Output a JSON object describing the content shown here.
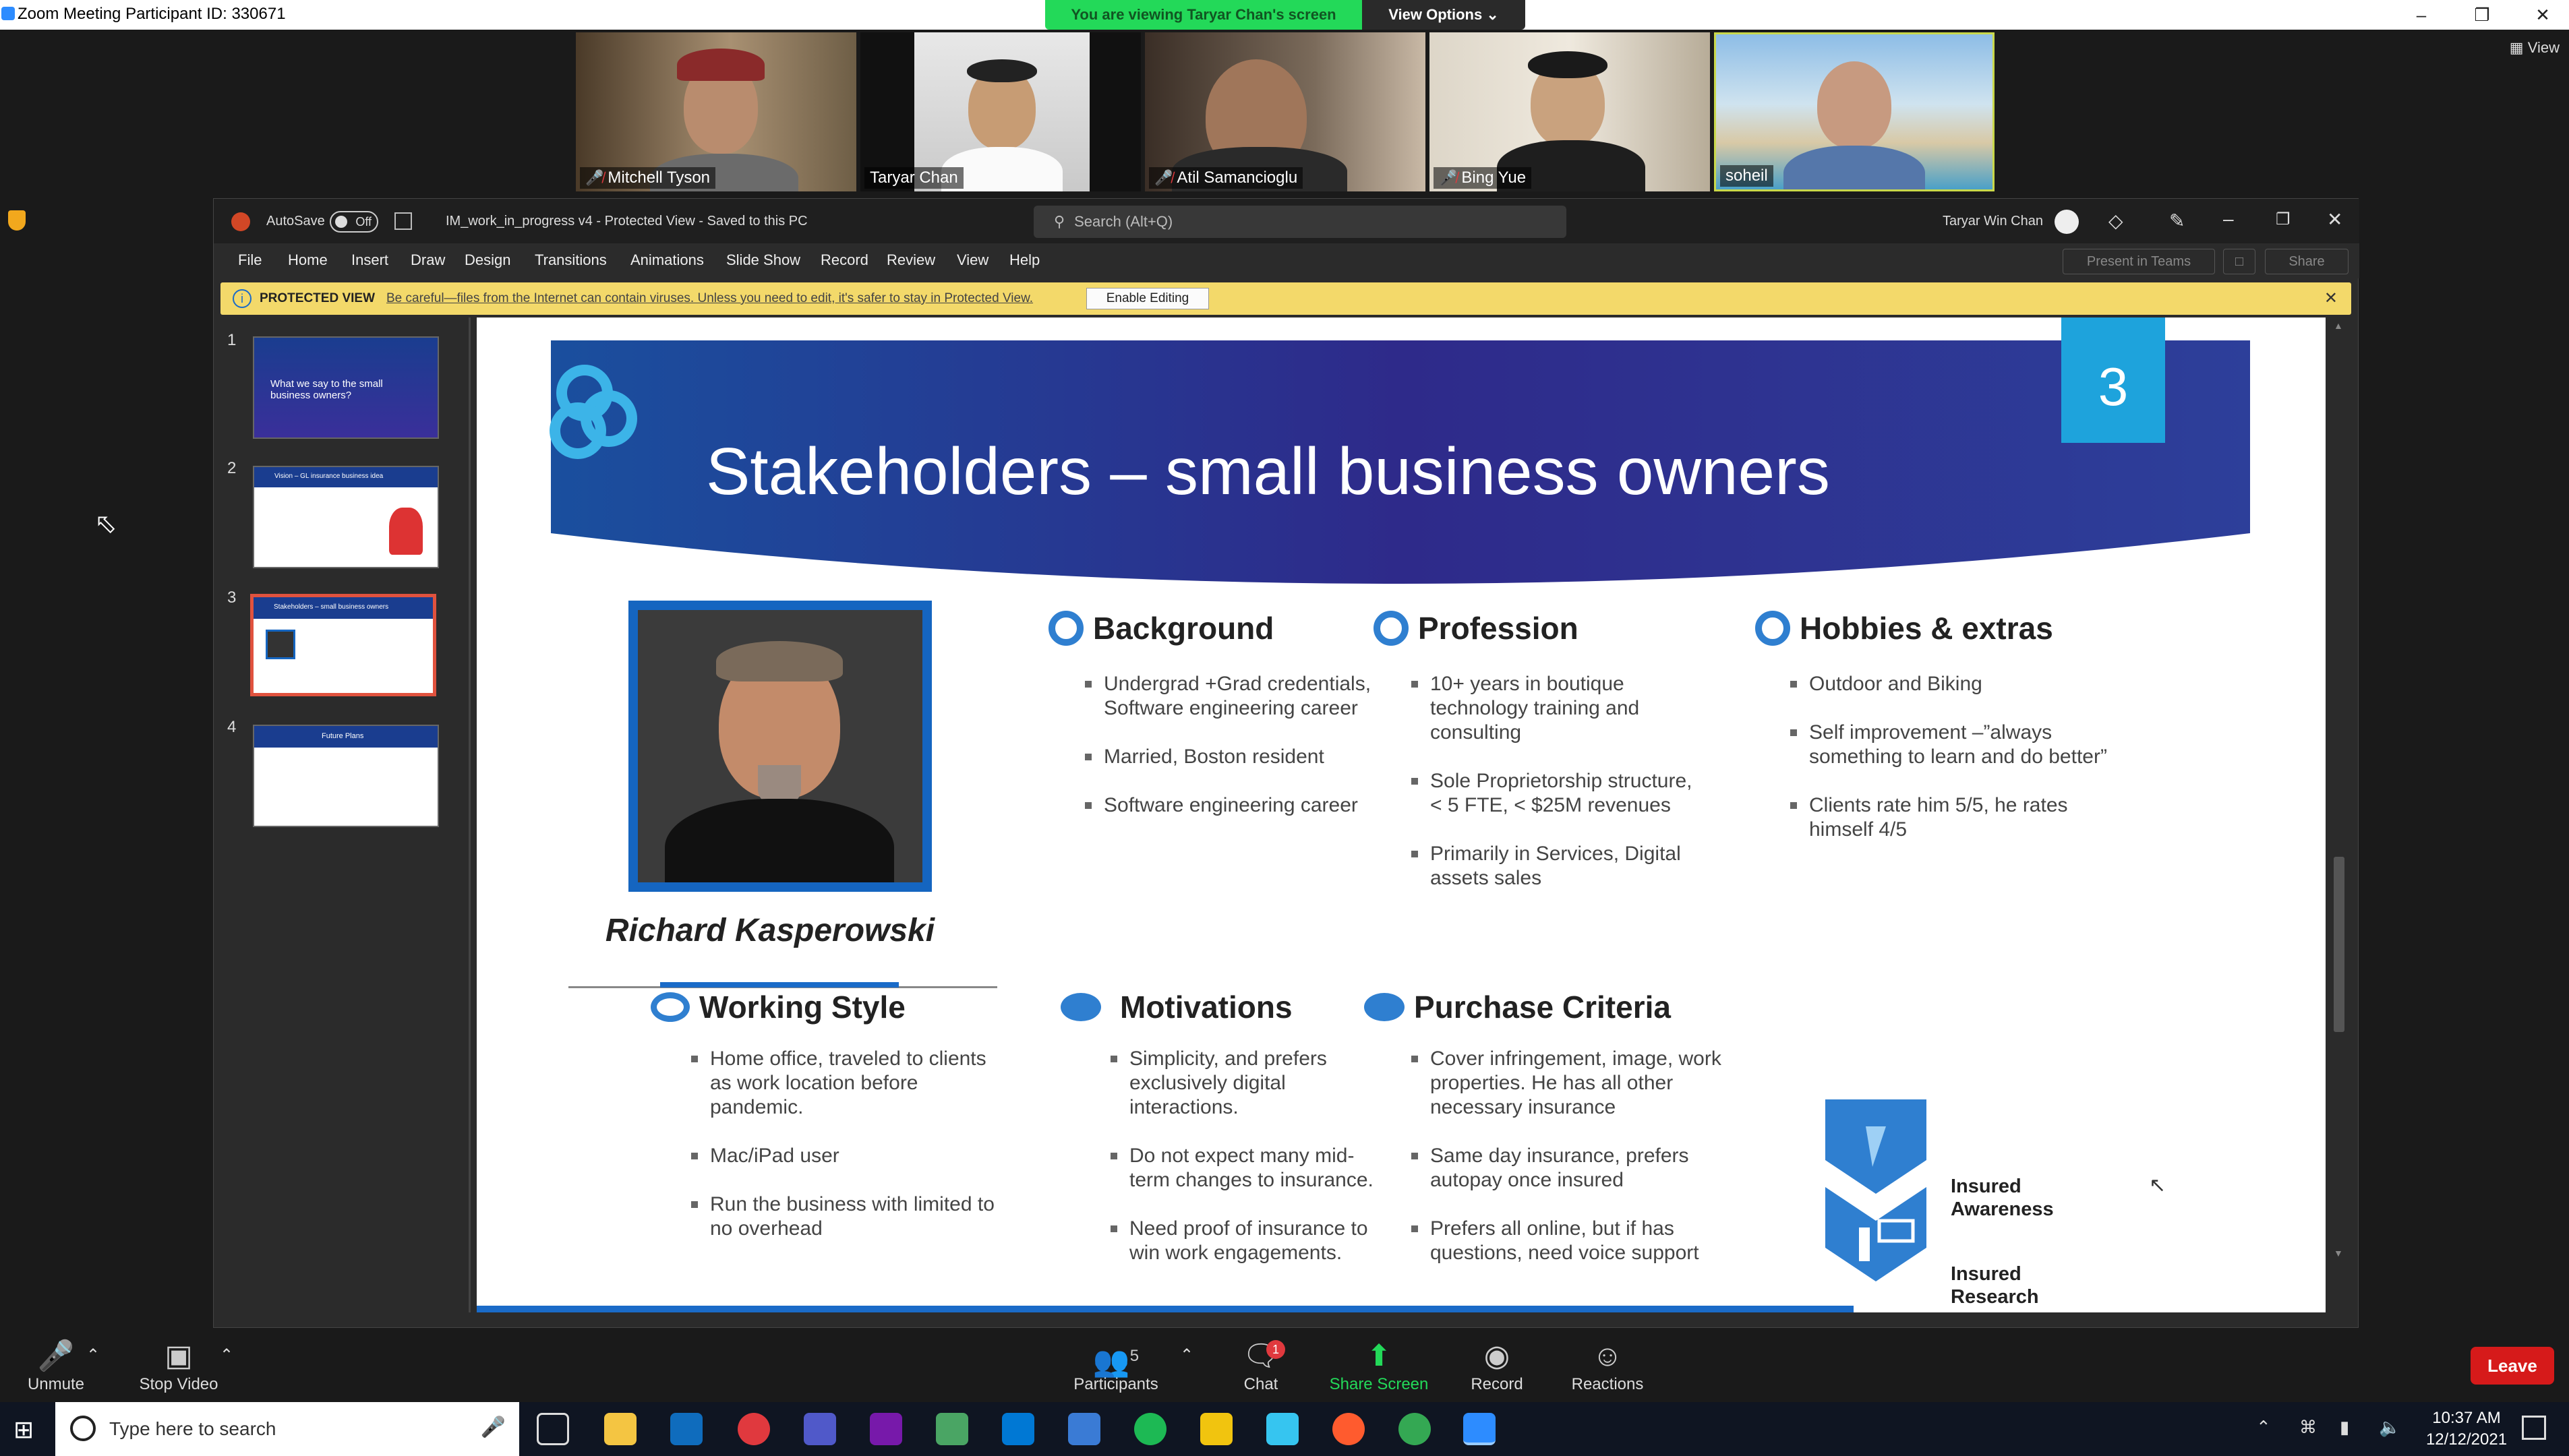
{
  "zoom": {
    "window_title": "Zoom Meeting Participant ID: 330671",
    "viewing_banner": "You are viewing Taryar Chan's screen",
    "view_options": "View Options",
    "view_button": "View",
    "participants": [
      {
        "name": "Mitchell Tyson",
        "muted": true
      },
      {
        "name": "Taryar Chan",
        "muted": false
      },
      {
        "name": "Atil Samancioglu",
        "muted": true
      },
      {
        "name": "Bing Yue",
        "muted": true
      },
      {
        "name": "soheil",
        "muted": false
      }
    ],
    "toolbar": {
      "unmute": "Unmute",
      "stop_video": "Stop Video",
      "participants": "Participants",
      "participants_count": "5",
      "chat": "Chat",
      "chat_badge": "1",
      "share_screen": "Share Screen",
      "record": "Record",
      "reactions": "Reactions",
      "leave": "Leave"
    }
  },
  "ppt": {
    "autosave_label": "AutoSave",
    "autosave_state": "Off",
    "doc_title": "IM_work_in_progress v4  -  Protected View  -  Saved to this PC",
    "search_placeholder": "Search (Alt+Q)",
    "user_name": "Taryar Win Chan",
    "menu": [
      "File",
      "Home",
      "Insert",
      "Draw",
      "Design",
      "Transitions",
      "Animations",
      "Slide Show",
      "Record",
      "Review",
      "View",
      "Help"
    ],
    "present_in_teams": "Present in Teams",
    "share": "Share",
    "protected_label": "PROTECTED VIEW",
    "protected_warning": "Be careful—files from the Internet can contain viruses. Unless you need to edit, it's safer to stay in Protected View.",
    "enable_editing": "Enable Editing",
    "thumbnails": [
      {
        "num": "1",
        "text": "What we say to the small business owners?"
      },
      {
        "num": "2",
        "text": "Vision – GL insurance business idea"
      },
      {
        "num": "3",
        "text": "Stakeholders – small business owners"
      },
      {
        "num": "4",
        "text": "Future Plans"
      }
    ]
  },
  "slide": {
    "number": "3",
    "title": "Stakeholders – small business owners",
    "person_name": "Richard Kasperowski",
    "sections": {
      "background": {
        "heading": "Background",
        "items": [
          "Undergrad +Grad credentials, Software engineering career",
          "Married, Boston resident",
          "Software engineering career"
        ]
      },
      "profession": {
        "heading": "Profession",
        "items": [
          "10+ years in boutique technology training and consulting",
          "Sole Proprietorship structure, < 5 FTE, < $25M revenues",
          "Primarily in Services, Digital assets sales"
        ]
      },
      "hobbies": {
        "heading": "Hobbies & extras",
        "items": [
          "Outdoor and Biking",
          "Self improvement –”always something to learn and do better”",
          "Clients rate him 5/5, he rates himself 4/5"
        ]
      },
      "working_style": {
        "heading": "Working Style",
        "items": [
          "Home office, traveled to clients as work location before pandemic.",
          "Mac/iPad user",
          "Run the business with limited to no overhead"
        ]
      },
      "motivations": {
        "heading": "Motivations",
        "items": [
          "Simplicity, and prefers exclusively digital interactions.",
          "Do not expect many mid-term changes to insurance.",
          "Need proof of insurance to win work engagements."
        ]
      },
      "purchase": {
        "heading": "Purchase Criteria",
        "items": [
          "Cover infringement, image, work properties.  He has all other necessary insurance",
          "Same day insurance, prefers autopay once insured",
          "Prefers all online, but if has questions, need voice support"
        ]
      }
    },
    "legend": [
      "Insured Awareness",
      "Insured Research"
    ]
  },
  "taskbar": {
    "search_placeholder": "Type here to search",
    "time": "10:37 AM",
    "date": "12/12/2021"
  }
}
